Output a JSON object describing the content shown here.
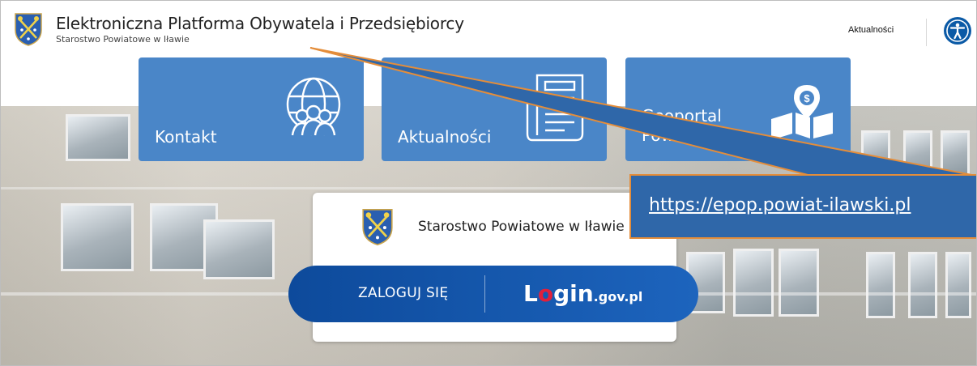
{
  "header": {
    "title": "Elektroniczna Platforma Obywatela i Przedsiębiorcy",
    "subtitle": "Starostwo Powiatowe w Iławie",
    "nav_news": "Aktualności",
    "accessibility_icon": "accessibility-icon"
  },
  "tiles": [
    {
      "label": "Kontakt",
      "icon": "globe-people-icon"
    },
    {
      "label": "Aktualności",
      "icon": "newspaper-icon"
    },
    {
      "label_line1": "Geoportal",
      "label_line2": "Powiatowy",
      "icon": "map-pin-money-icon"
    }
  ],
  "card": {
    "office_name": "Starostwo Powiatowe w Iławie",
    "login_label": "ZALOGUJ SIĘ",
    "gov_logo": {
      "part1": "L",
      "part2": "o",
      "part3": "gin",
      "suffix": ".gov.pl"
    }
  },
  "callout": {
    "url": "https://epop.powiat-ilawski.pl",
    "color": "#2f67a9",
    "border_color": "#e48d3a"
  },
  "colors": {
    "tile_blue": "#4a86c8",
    "login_blue": "#0d4a9b",
    "gov_red": "#e2203b"
  }
}
